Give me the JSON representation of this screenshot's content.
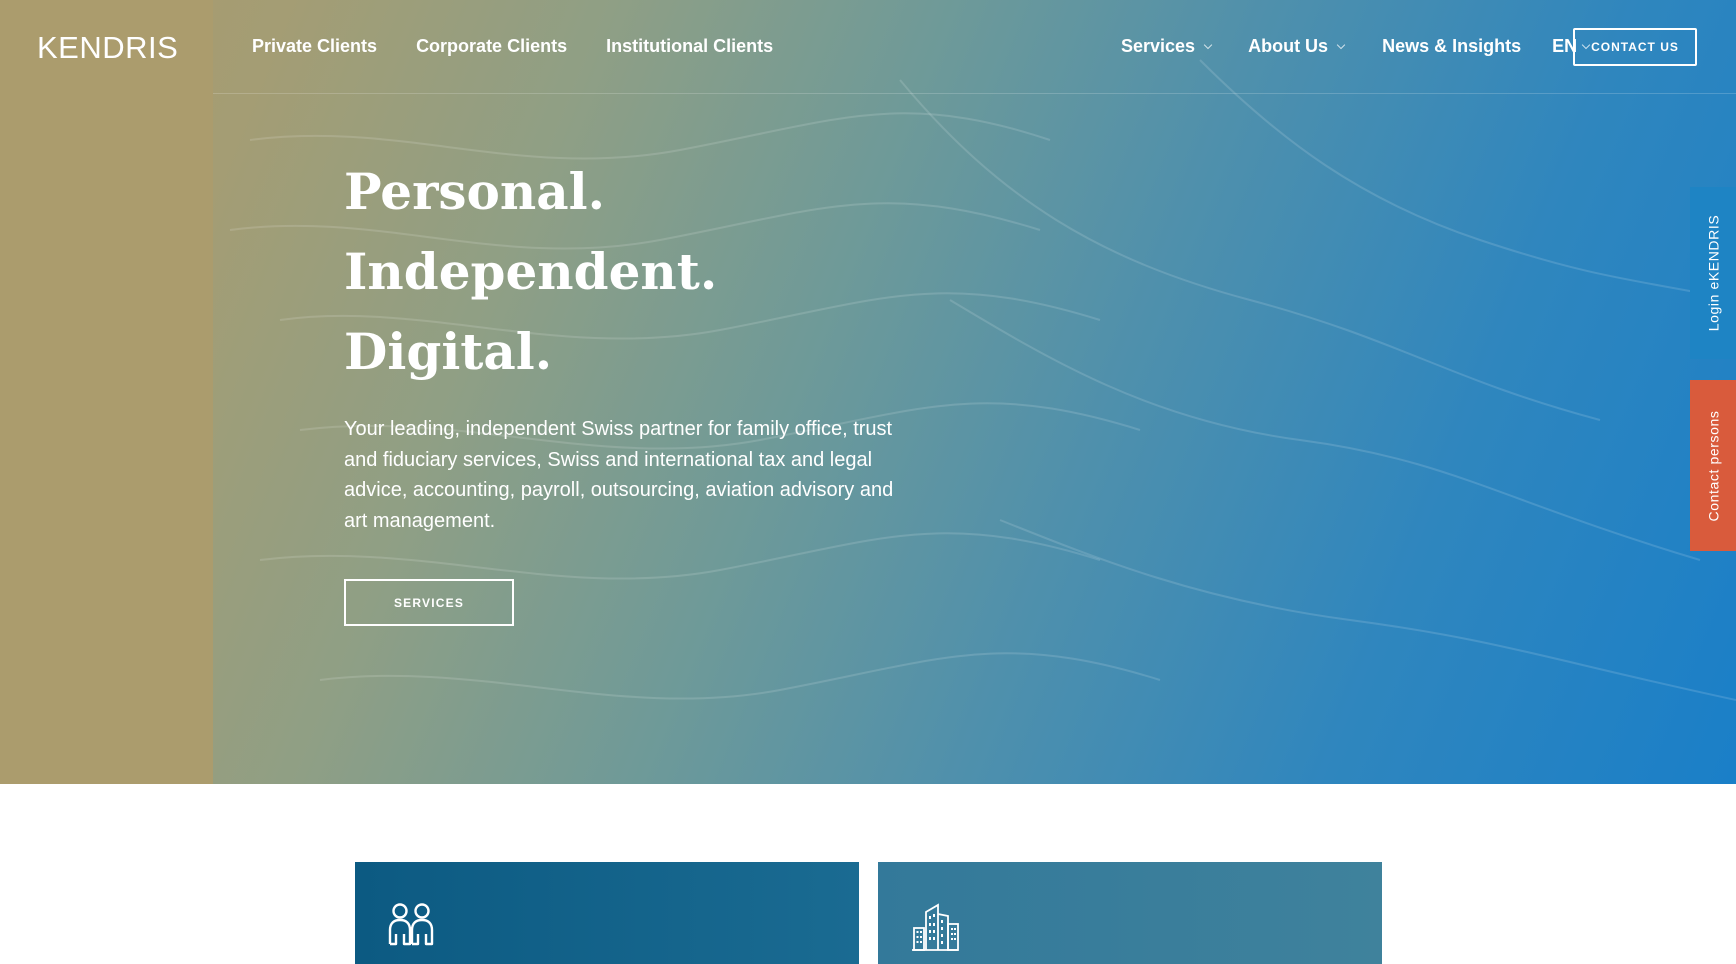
{
  "header": {
    "logo": "KENDRIS",
    "nav_left": [
      "Private Clients",
      "Corporate Clients",
      "Institutional Clients"
    ],
    "nav_right": {
      "services": "Services",
      "about": "About Us",
      "news": "News & Insights",
      "language": "EN"
    },
    "contact_button": "CONTACT US"
  },
  "hero": {
    "headline": [
      "Personal.",
      "Independent.",
      "Digital."
    ],
    "lede": "Your leading, independent Swiss partner for family office, trust and fiduciary services, Swiss and international tax and legal advice, accounting, payroll, outsourcing, aviation advisory and art management.",
    "cta": "SERVICES"
  },
  "side_tabs": {
    "login": "Login eKENDRIS",
    "contact_persons": "Contact persons"
  },
  "cards": [
    {
      "icon": "people-icon"
    },
    {
      "icon": "office-building-icon"
    }
  ],
  "colors": {
    "gold": "#ab9c6d",
    "blue": "#1a7fc8",
    "login_tab": "#1e84c4",
    "contact_tab": "#d95b3c",
    "card_dark": "#115f86",
    "card_light": "#3a7d9a"
  }
}
